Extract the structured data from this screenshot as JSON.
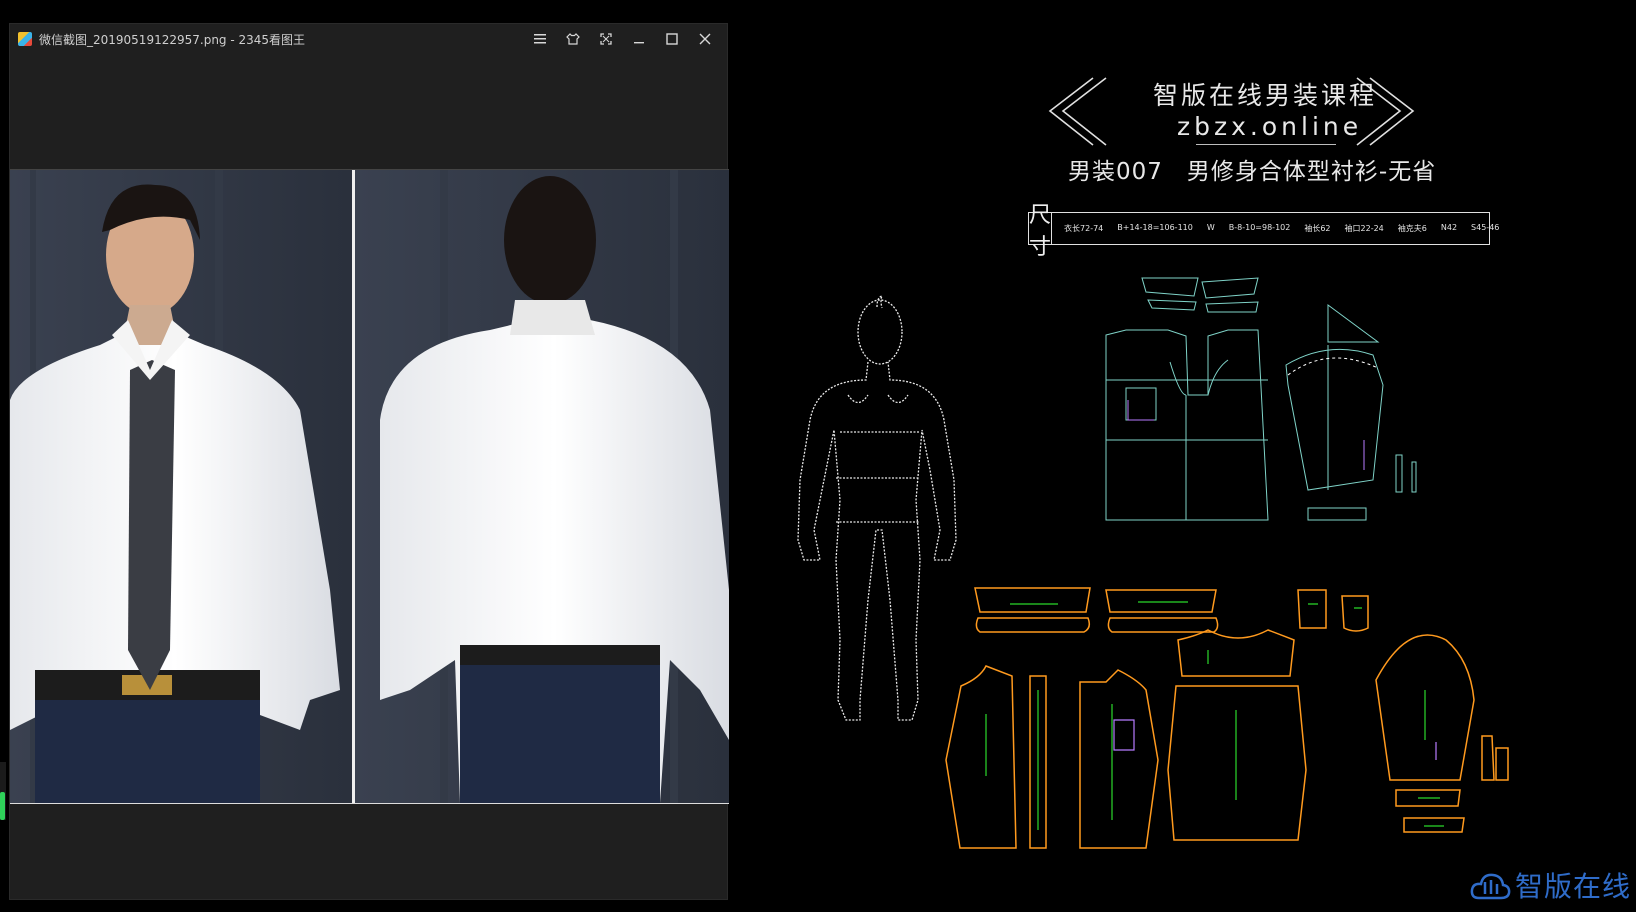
{
  "viewer": {
    "title": "微信截图_20190519122957.png - 2345看图王",
    "controls": [
      "menu-icon",
      "skin-icon",
      "fullscreen-icon",
      "minimize-icon",
      "maximize-icon",
      "close-icon"
    ]
  },
  "cad": {
    "header_title": "智版在线男装课程",
    "header_sub": "zbzx.online",
    "course_name": "男装007　男修身合体型衬衫-无省",
    "size_label": "尺寸",
    "size_items": [
      "衣长72-74",
      "B+14-18=106-110",
      "W",
      "B-8-10=98-102",
      "袖长62",
      "袖口22-24",
      "袖克夫6",
      "N42",
      "S45-46"
    ],
    "brand": "智版在线"
  },
  "colors": {
    "viewer_bg": "#1f1f1f",
    "canvas_bg": "#000000",
    "pattern_outline": "#ff9a1e",
    "draft_line": "#7fd3c8",
    "grain_line": "#2bd82b",
    "brand_blue": "#2f6cc9"
  }
}
